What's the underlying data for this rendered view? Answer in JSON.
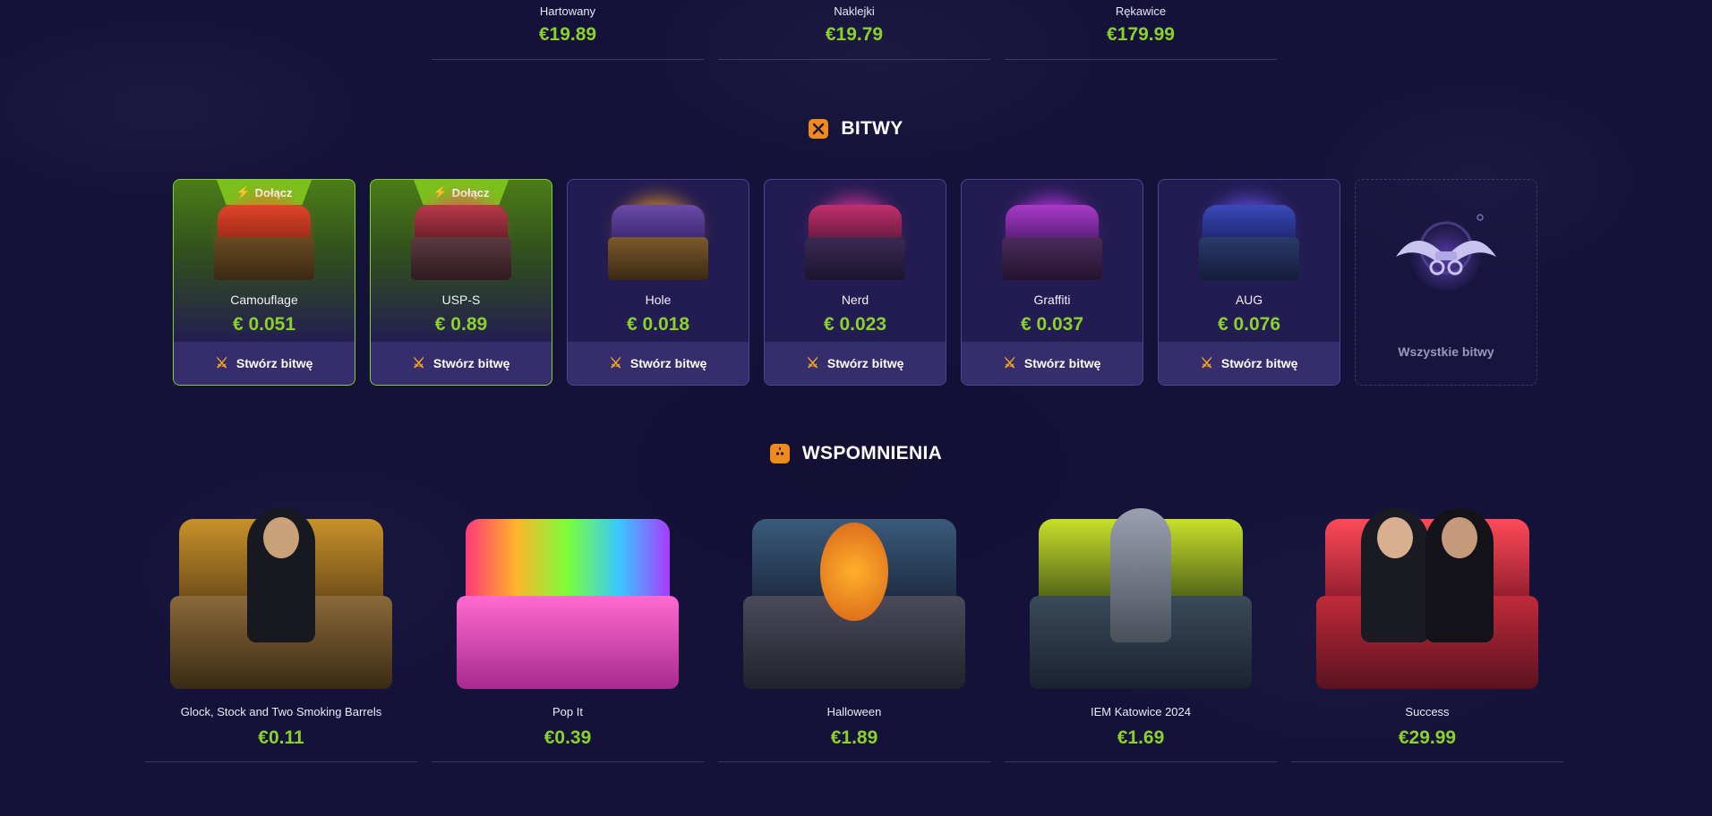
{
  "top_items": [
    {
      "name": "Hartowany",
      "price": "€19.89"
    },
    {
      "name": "Naklejki",
      "price": "€19.79"
    },
    {
      "name": "Rękawice",
      "price": "€179.99"
    }
  ],
  "battles": {
    "title": "BITWY",
    "icon": "battle-icon",
    "cards": [
      {
        "name": "Camouflage",
        "price": "€ 0.051",
        "join_label": "Dołącz",
        "create_label": "Stwórz bitwę"
      },
      {
        "name": "USP-S",
        "price": "€ 0.89",
        "join_label": "Dołącz",
        "create_label": "Stwórz bitwę"
      },
      {
        "name": "Hole",
        "price": "€ 0.018",
        "create_label": "Stwórz bitwę"
      },
      {
        "name": "Nerd",
        "price": "€ 0.023",
        "create_label": "Stwórz bitwę"
      },
      {
        "name": "Graffiti",
        "price": "€ 0.037",
        "create_label": "Stwórz bitwę"
      },
      {
        "name": "AUG",
        "price": "€ 0.076",
        "create_label": "Stwórz bitwę"
      }
    ],
    "all_label": "Wszystkie bitwy"
  },
  "memories": {
    "title": "WSPOMNIENIA",
    "icon": "pumpkin-icon",
    "items": [
      {
        "name": "Glock, Stock and Two Smoking Barrels",
        "price": "€0.11"
      },
      {
        "name": "Pop It",
        "price": "€0.39"
      },
      {
        "name": "Halloween",
        "price": "€1.89"
      },
      {
        "name": "IEM Katowice 2024",
        "price": "€1.69"
      },
      {
        "name": "Success",
        "price": "€29.99"
      }
    ]
  },
  "colors": {
    "background": "#15123a",
    "price_green": "#8ad12a",
    "accent_orange": "#f08a1c",
    "active_border": "#86d02a",
    "card_border": "#4e448a"
  }
}
